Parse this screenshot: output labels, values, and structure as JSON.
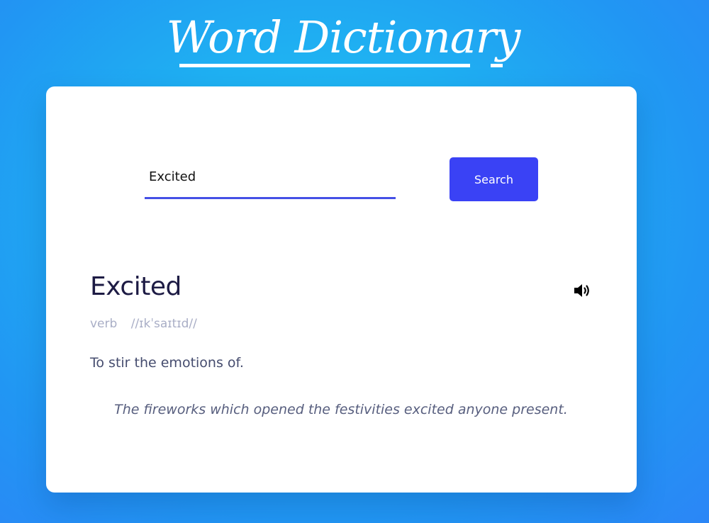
{
  "app": {
    "title": "Word Dictionary"
  },
  "search": {
    "value": "Excited",
    "placeholder": "",
    "button_label": "Search"
  },
  "result": {
    "word": "Excited",
    "part_of_speech": "verb",
    "phonetic": "//ɪkˈsaɪtɪd//",
    "definition": "To stir the emotions of.",
    "example": "The fireworks which opened the festivities excited anyone present.",
    "sound_icon": "speaker-volume-icon"
  },
  "colors": {
    "accent": "#3a42f5",
    "underline": "#4450e6",
    "word": "#1d1b44",
    "meta": "#a9aec6",
    "text": "#454c6e",
    "background_start": "#1fc0f3",
    "background_end": "#2b86f6"
  }
}
